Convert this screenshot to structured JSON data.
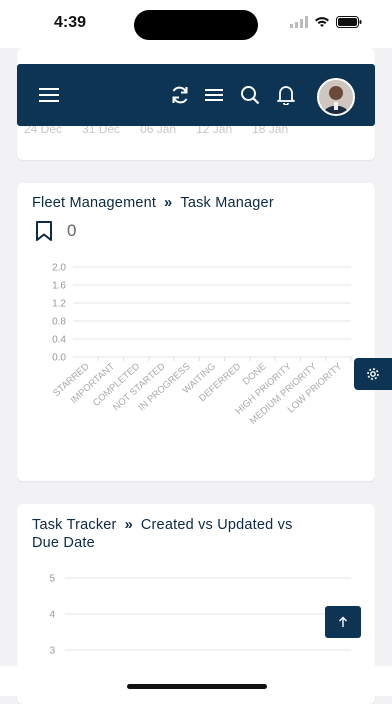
{
  "status_bar": {
    "time": "4:39"
  },
  "prev_card": {
    "x_ticks": [
      "24 Dec",
      "31 Dec",
      "06 Jan",
      "12 Jan",
      "18 Jan"
    ]
  },
  "navbar": {
    "icons": [
      "menu-icon",
      "refresh-icon",
      "list-icon",
      "search-icon",
      "bell-icon",
      "avatar"
    ]
  },
  "fleet_card": {
    "breadcrumb_parent": "Fleet Management",
    "separator": "»",
    "breadcrumb_child": "Task Manager",
    "count": "0"
  },
  "tracker_card": {
    "breadcrumb_parent": "Task Tracker",
    "separator": "»",
    "breadcrumb_child_line1": "Created vs Updated vs",
    "breadcrumb_child_line2": "Due Date"
  },
  "chart_data": [
    {
      "type": "bar",
      "categories": [
        "STARRED",
        "IMPORTANT",
        "COMPLETED",
        "NOT STARTED",
        "IN PROGRESS",
        "WAITING",
        "DEFERRED",
        "DONE",
        "HIGH PRIORITY",
        "MEDIUM PRIORITY",
        "LOW PRIORITY"
      ],
      "values": [
        0,
        0,
        0,
        0,
        0,
        0,
        0,
        0,
        0,
        0,
        0
      ],
      "yticks": [
        "2.0",
        "1.6",
        "1.2",
        "0.8",
        "0.4",
        "0.0"
      ],
      "ylim": [
        0,
        2
      ],
      "grid": true
    },
    {
      "type": "line",
      "yticks": [
        "5",
        "4",
        "3"
      ],
      "grid": true
    }
  ]
}
